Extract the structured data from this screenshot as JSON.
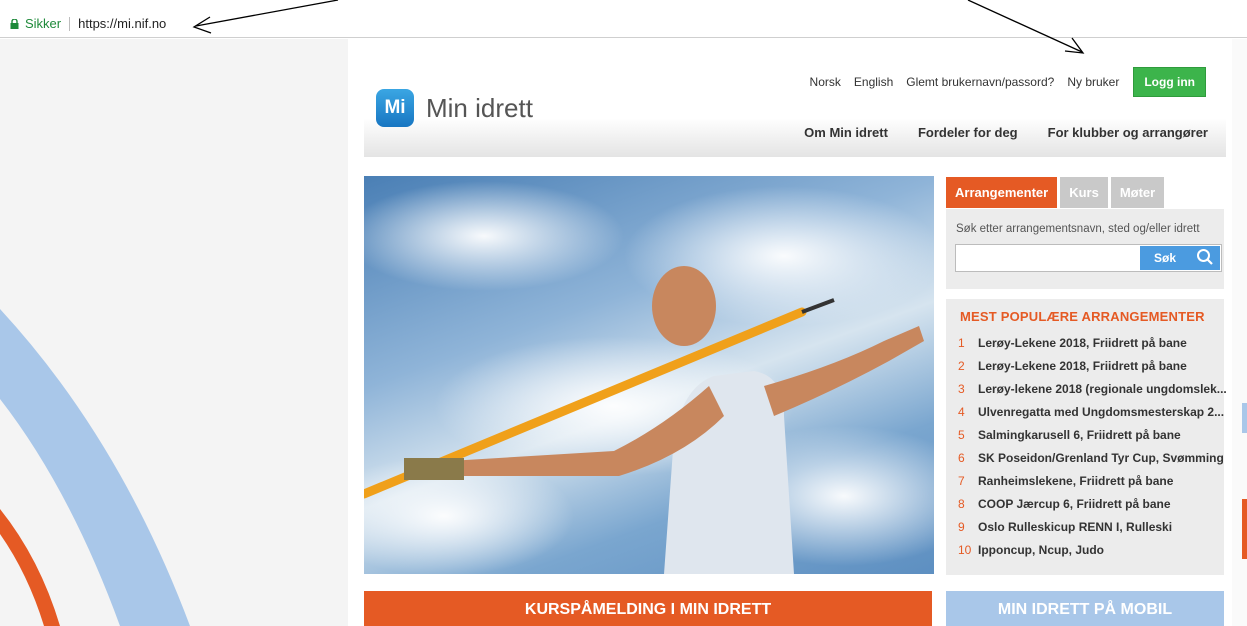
{
  "browser": {
    "secure_label": "Sikker",
    "url": "https://mi.nif.no"
  },
  "topnav": {
    "items": [
      "Norsk",
      "English",
      "Glemt brukernavn/passord?",
      "Ny bruker"
    ],
    "login": "Logg inn"
  },
  "logo": {
    "badge": "Mi",
    "text": "Min idrett"
  },
  "mainnav": {
    "items": [
      "Om Min idrett",
      "Fordeler for deg",
      "For klubber og arrangører"
    ]
  },
  "tabs": {
    "items": [
      "Arrangementer",
      "Kurs",
      "Møter"
    ]
  },
  "search": {
    "label": "Søk etter arrangementsnavn, sted og/eller idrett",
    "value": "",
    "button": "Søk"
  },
  "popular": {
    "title": "MEST POPULÆRE ARRANGEMENTER",
    "items": [
      {
        "num": "1",
        "text": "Lerøy-Lekene 2018, Friidrett på bane"
      },
      {
        "num": "2",
        "text": "Lerøy-Lekene 2018, Friidrett på bane"
      },
      {
        "num": "3",
        "text": "Lerøy-lekene 2018 (regionale ungdomslek..."
      },
      {
        "num": "4",
        "text": "Ulvenregatta med Ungdomsmesterskap 2..."
      },
      {
        "num": "5",
        "text": "Salmingkarusell 6, Friidrett på bane"
      },
      {
        "num": "6",
        "text": "SK Poseidon/Grenland Tyr Cup, Svømming"
      },
      {
        "num": "7",
        "text": "Ranheimslekene, Friidrett på bane"
      },
      {
        "num": "8",
        "text": "COOP Jærcup 6, Friidrett på bane"
      },
      {
        "num": "9",
        "text": "Oslo Rulleskicup RENN I, Rulleski"
      },
      {
        "num": "10",
        "text": "Ipponcup, Ncup, Judo"
      }
    ]
  },
  "banners": {
    "orange": "KURSPÅMELDING I MIN IDRETT",
    "blue": "MIN IDRETT PÅ MOBIL"
  },
  "colors": {
    "accent_orange": "#e55a24",
    "login_green": "#3cb44b",
    "logo_blue": "#1876c2",
    "banner_blue": "#a9c7e9"
  }
}
